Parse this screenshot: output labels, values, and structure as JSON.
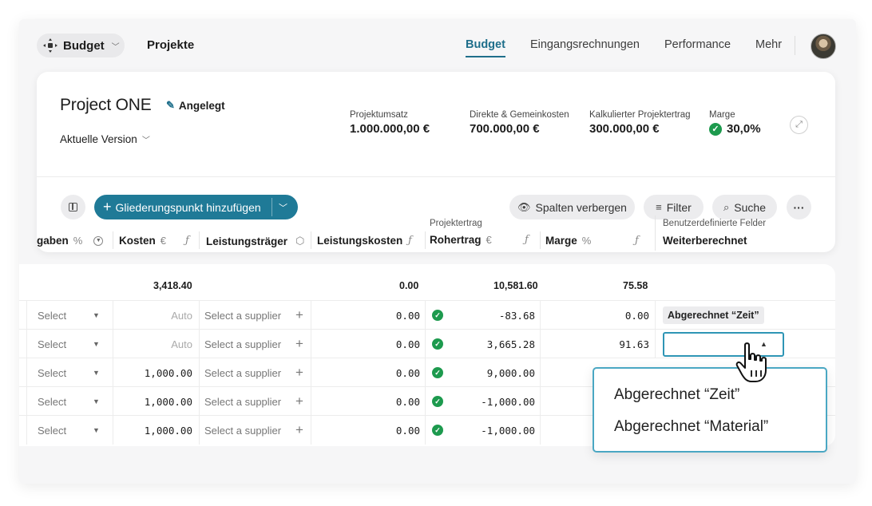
{
  "nav": {
    "app_label": "Budget",
    "projects_label": "Projekte",
    "tabs": [
      {
        "label": "Budget",
        "active": true
      },
      {
        "label": "Eingangsrechnungen",
        "active": false
      },
      {
        "label": "Performance",
        "active": false
      },
      {
        "label": "Mehr",
        "active": false
      }
    ]
  },
  "project": {
    "title": "Project ONE",
    "status": "Angelegt",
    "version": "Aktuelle Version"
  },
  "kpis": [
    {
      "label": "Projektumsatz",
      "value": "1.000.000,00 €"
    },
    {
      "label": "Direkte & Gemeinkosten",
      "value": "700.000,00 €"
    },
    {
      "label": "Kalkulierter Projektertrag",
      "value": "300.000,00 €"
    },
    {
      "label": "Marge",
      "value": "30,0%"
    }
  ],
  "toolbar": {
    "add_label": "Gliederungspunkt hinzufügen",
    "hide_columns": "Spalten verbergen",
    "filter": "Filter",
    "search": "Suche",
    "more": "···"
  },
  "columns": {
    "abgaben": "gaben",
    "abgaben_unit": "%",
    "kosten": "Kosten",
    "kosten_unit": "€",
    "leistungstraeger": "Leistungsträger",
    "leistungskosten": "Leistungskosten",
    "group_projektertrag": "Projektertrag",
    "rohertrag": "Rohertrag",
    "rohertrag_unit": "€",
    "marge": "Marge",
    "marge_unit": "%",
    "group_custom": "Benutzerdefinierte Felder",
    "weiterberechnet": "Weiterberechnet",
    "formula_symbol": "ƒ"
  },
  "totals": {
    "kosten": "3,418.40",
    "leistungskosten": "0.00",
    "rohertrag": "10,581.60",
    "marge": "75.58"
  },
  "rows": [
    {
      "select": "Select",
      "kosten": "Auto",
      "supplier": "Select a supplier",
      "leistungskosten": "0.00",
      "rohertrag": "-83.68",
      "marge": "0.00",
      "weiter": "Abgerechnet “Zeit”"
    },
    {
      "select": "Select",
      "kosten": "Auto",
      "supplier": "Select a supplier",
      "leistungskosten": "0.00",
      "rohertrag": "3,665.28",
      "marge": "91.63",
      "weiter": ""
    },
    {
      "select": "Select",
      "kosten": "1,000.00",
      "supplier": "Select a supplier",
      "leistungskosten": "0.00",
      "rohertrag": "9,000.00",
      "marge": "",
      "weiter": ""
    },
    {
      "select": "Select",
      "kosten": "1,000.00",
      "supplier": "Select a supplier",
      "leistungskosten": "0.00",
      "rohertrag": "-1,000.00",
      "marge": "",
      "weiter": ""
    },
    {
      "select": "Select",
      "kosten": "1,000.00",
      "supplier": "Select a supplier",
      "leistungskosten": "0.00",
      "rohertrag": "-1,000.00",
      "marge": "",
      "weiter": ""
    }
  ],
  "dropdown": {
    "options": [
      "Abgerechnet “Zeit”",
      "Abgerechnet “Material”"
    ]
  },
  "colors": {
    "accent": "#1f7a97",
    "success": "#1d9a4e",
    "focus": "#2e95b5"
  }
}
